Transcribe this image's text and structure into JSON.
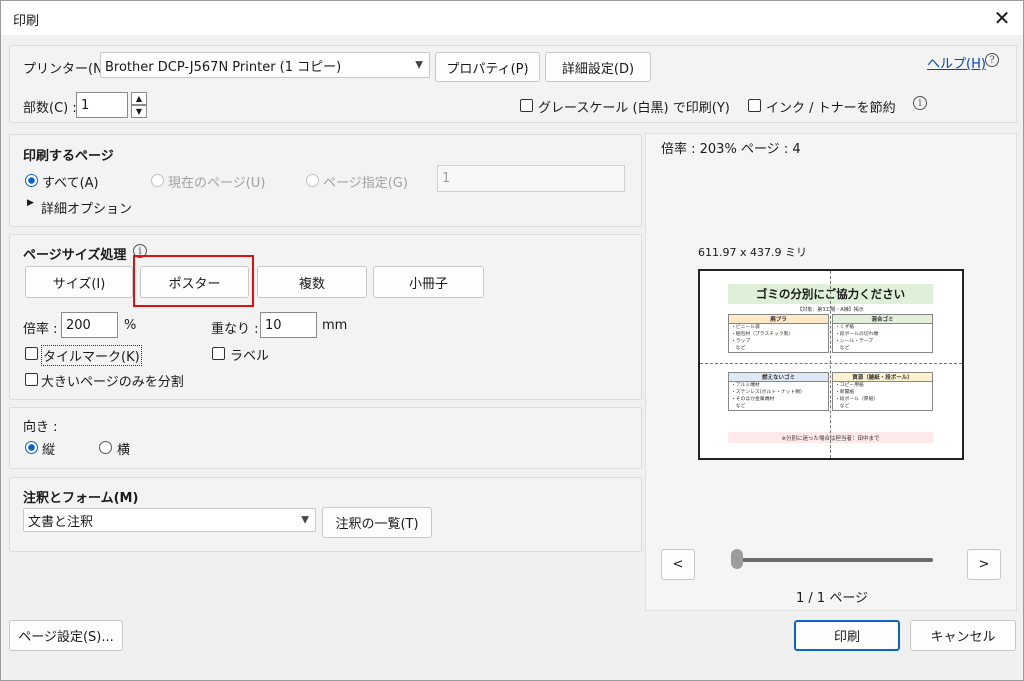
{
  "window": {
    "title": "印刷"
  },
  "printer": {
    "label": "プリンター(N) :",
    "selected": "Brother DCP-J567N Printer (1 コピー)",
    "properties_label": "プロパティ(P)",
    "advanced_label": "詳細設定(D)",
    "help_label": "ヘルプ(H)"
  },
  "copies": {
    "label": "部数(C) :",
    "value": "1"
  },
  "options": {
    "grayscale_label": "グレースケール (白黒) で印刷(Y)",
    "save_ink_label": "インク / トナーを節約"
  },
  "pages": {
    "heading": "印刷するページ",
    "all_label": "すべて(A)",
    "current_label": "現在のページ(U)",
    "range_label": "ページ指定(G)",
    "range_value": "1",
    "more_options_label": "詳細オプション"
  },
  "page_sizing": {
    "heading": "ページサイズ処理",
    "tabs": [
      "サイズ(I)",
      "ポスター",
      "複数",
      "小冊子"
    ],
    "scale_label": "倍率 :",
    "scale_value": "200",
    "scale_unit": "%",
    "overlap_label": "重なり :",
    "overlap_value": "10",
    "overlap_unit": "mm",
    "tile_marks_label": "タイルマーク(K)",
    "labels_label": "ラベル",
    "large_only_label": "大きいページのみを分割"
  },
  "orientation": {
    "heading": "向き :",
    "portrait_label": "縦",
    "landscape_label": "横"
  },
  "comments": {
    "heading": "注釈とフォーム(M)",
    "selected": "文書と注釈",
    "summary_label": "注釈の一覧(T)"
  },
  "preview": {
    "info": "倍率 : 203% ページ : 4",
    "dimensions": "611.97 x 437.9 ミリ",
    "prev_label": "<",
    "next_label": ">",
    "page_indicator": "1 / 1 ページ",
    "slider_position": 0,
    "poster": {
      "title": "ゴミの分別にご協力ください",
      "subtitle": "【対象：第3工場・A棟】掲示",
      "categories": [
        {
          "name": "廃プラ",
          "color": "#fde8c8",
          "items": [
            "・ビニール袋",
            "・梱包材（プラスチック製）",
            "・ラップ",
            "　など"
          ]
        },
        {
          "name": "混合ゴミ",
          "color": "#e3efd9",
          "items": [
            "・くず紙",
            "・段ボールの切れ端",
            "・シール・テープ",
            "　など"
          ]
        },
        {
          "name": "燃えないゴミ",
          "color": "#dfe9f5",
          "items": [
            "・アルミ端材",
            "・ステンレス(ボルト・ナット類)",
            "・そのほか金属端材",
            "　など"
          ]
        },
        {
          "name": "資源（雑紙・段ボール）",
          "color": "#fdf2d0",
          "items": [
            "・コピー用紙",
            "・新聞紙",
            "・段ボール（厚紙）",
            "　など"
          ]
        }
      ],
      "footer": "※分別に迷った場合は担当者：田中まで"
    }
  },
  "footer": {
    "page_setup_label": "ページ設定(S)...",
    "print_label": "印刷",
    "cancel_label": "キャンセル"
  },
  "colors": {
    "accent": "#0a64c8",
    "highlight": "#e01010"
  }
}
